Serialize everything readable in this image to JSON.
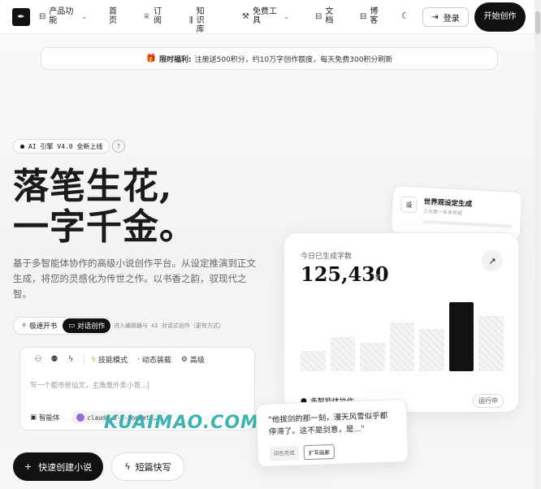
{
  "nav": {
    "products": "产品功能",
    "home": "首页",
    "subscribe": "订阅",
    "knowledge": "知识库",
    "tools": "免费工具",
    "docs": "文档",
    "blog": "博客",
    "login": "登录",
    "start": "开始创作"
  },
  "banner": {
    "label": "限时福利:",
    "text": "注册送500积分，约10万字创作额度，每天免费300积分刷新"
  },
  "hero": {
    "badge": "AI 引擎 V4.0 全新上线",
    "help": "?",
    "headline_line1": "落笔生花,",
    "headline_line2": "一字千金。",
    "description": "基于多智能体协作的高级小说创作平台。从设定推演到正文生成，将您的灵感化为传世之作。以书香之韵，驭现代之智。"
  },
  "modes": {
    "quick": "极速开书",
    "chat": "对话创作",
    "hint": "进入编辑器与 AI 对话式创作（更有方式）"
  },
  "editor": {
    "skill_mode": "技能模式",
    "dynamic": "动态装载",
    "advanced": "高级",
    "placeholder": "写一个都市修仙文，主角是外卖小哥...|",
    "agent": "智能体",
    "model": "claude-3-5-sonnet-…"
  },
  "cta": {
    "quick_create": "快速创建小说",
    "short_write": "短篇快写"
  },
  "watermark": "KUAIMAO.COM",
  "world_card": {
    "icon": "设",
    "title": "世界观设定生成",
    "subtitle": "三元素一系体世组"
  },
  "stats": {
    "label": "今日已生成字数",
    "value": "125,430",
    "unit": "字",
    "status_label": "多智能体协作",
    "status": "运行中"
  },
  "chart_data": {
    "type": "bar",
    "values": [
      25,
      42,
      35,
      60,
      52,
      85,
      68
    ],
    "highlight_index": 5,
    "ylim": [
      0,
      100
    ]
  },
  "quote": {
    "text": "\"他拔剑的那一刻，漫天风雪似乎都停滞了。这不是剑意，是...\"",
    "tag1": "润色完成",
    "tag2": "扩写画廊"
  }
}
